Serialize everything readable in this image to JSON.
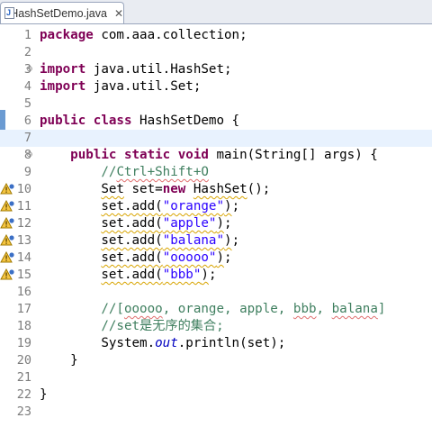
{
  "tab": {
    "title": "HashSetDemo.java",
    "close": "✕",
    "file_icon": "J"
  },
  "lines": [
    {
      "n": "1",
      "segs": [
        {
          "t": "package",
          "c": "kw"
        },
        {
          "t": " com.aaa.collection;"
        }
      ]
    },
    {
      "n": "2",
      "segs": []
    },
    {
      "n": "3",
      "fold": "⊖",
      "segs": [
        {
          "t": "import",
          "c": "kw"
        },
        {
          "t": " java.util.HashSet;"
        }
      ]
    },
    {
      "n": "4",
      "segs": [
        {
          "t": "import",
          "c": "kw"
        },
        {
          "t": " java.util.Set;"
        }
      ]
    },
    {
      "n": "5",
      "segs": []
    },
    {
      "n": "6",
      "segs": [
        {
          "t": "public",
          "c": "kw"
        },
        {
          "t": " "
        },
        {
          "t": "class",
          "c": "kw"
        },
        {
          "t": " HashSetDemo {"
        }
      ]
    },
    {
      "n": "7",
      "current": true,
      "segs": []
    },
    {
      "n": "8",
      "fold": "⊖",
      "segs": [
        {
          "t": "    "
        },
        {
          "t": "public",
          "c": "kw"
        },
        {
          "t": " "
        },
        {
          "t": "static",
          "c": "kw"
        },
        {
          "t": " "
        },
        {
          "t": "void",
          "c": "kw"
        },
        {
          "t": " main(String[] args) {"
        }
      ]
    },
    {
      "n": "9",
      "segs": [
        {
          "t": "        "
        },
        {
          "t": "//",
          "c": "cmt"
        },
        {
          "t": "Ctrl+Shift+O",
          "c": "cmt spell"
        }
      ]
    },
    {
      "n": "10",
      "warn": true,
      "segs": [
        {
          "t": "        "
        },
        {
          "t": "Set",
          "c": "warnul"
        },
        {
          "t": " set="
        },
        {
          "t": "new",
          "c": "kw"
        },
        {
          "t": " "
        },
        {
          "t": "HashSet",
          "c": "warnul"
        },
        {
          "t": "();"
        }
      ]
    },
    {
      "n": "11",
      "warn": true,
      "segs": [
        {
          "t": "        "
        },
        {
          "t": "set.add(",
          "c": "warnul"
        },
        {
          "t": "\"orange\"",
          "c": "str warnul"
        },
        {
          "t": ")",
          "c": "warnul"
        },
        {
          "t": ";"
        }
      ]
    },
    {
      "n": "12",
      "warn": true,
      "segs": [
        {
          "t": "        "
        },
        {
          "t": "set.add(",
          "c": "warnul"
        },
        {
          "t": "\"apple\"",
          "c": "str warnul"
        },
        {
          "t": ")",
          "c": "warnul"
        },
        {
          "t": ";"
        }
      ]
    },
    {
      "n": "13",
      "warn": true,
      "segs": [
        {
          "t": "        "
        },
        {
          "t": "set.add(",
          "c": "warnul"
        },
        {
          "t": "\"balana\"",
          "c": "str warnul"
        },
        {
          "t": ")",
          "c": "warnul"
        },
        {
          "t": ";"
        }
      ]
    },
    {
      "n": "14",
      "warn": true,
      "segs": [
        {
          "t": "        "
        },
        {
          "t": "set.add(",
          "c": "warnul"
        },
        {
          "t": "\"ooooo\"",
          "c": "str warnul"
        },
        {
          "t": ")",
          "c": "warnul"
        },
        {
          "t": ";"
        }
      ]
    },
    {
      "n": "15",
      "warn": true,
      "segs": [
        {
          "t": "        "
        },
        {
          "t": "set.add(",
          "c": "warnul"
        },
        {
          "t": "\"bbb\"",
          "c": "str warnul"
        },
        {
          "t": ")",
          "c": "warnul"
        },
        {
          "t": ";"
        }
      ]
    },
    {
      "n": "16",
      "segs": []
    },
    {
      "n": "17",
      "segs": [
        {
          "t": "        "
        },
        {
          "t": "//[",
          "c": "cmt"
        },
        {
          "t": "ooooo",
          "c": "cmt spell"
        },
        {
          "t": ", orange, apple, ",
          "c": "cmt"
        },
        {
          "t": "bbb",
          "c": "cmt spell"
        },
        {
          "t": ", ",
          "c": "cmt"
        },
        {
          "t": "balana",
          "c": "cmt spell"
        },
        {
          "t": "]",
          "c": "cmt"
        }
      ]
    },
    {
      "n": "18",
      "segs": [
        {
          "t": "        "
        },
        {
          "t": "//set是无序的集合;",
          "c": "cmt"
        }
      ]
    },
    {
      "n": "19",
      "segs": [
        {
          "t": "        System."
        },
        {
          "t": "out",
          "c": "fld"
        },
        {
          "t": ".println(set);"
        }
      ]
    },
    {
      "n": "20",
      "segs": [
        {
          "t": "    }"
        }
      ]
    },
    {
      "n": "21",
      "segs": []
    },
    {
      "n": "22",
      "segs": [
        {
          "t": "}"
        }
      ]
    },
    {
      "n": "23",
      "segs": []
    }
  ],
  "icons": {
    "warning": "warning-icon",
    "fold": "fold-toggle-icon",
    "file": "java-file-icon"
  },
  "colors": {
    "keyword": "#7f0055",
    "string": "#2a00ff",
    "comment": "#3f7f5f",
    "field": "#0000c0",
    "current_line": "#e8f2fe"
  }
}
